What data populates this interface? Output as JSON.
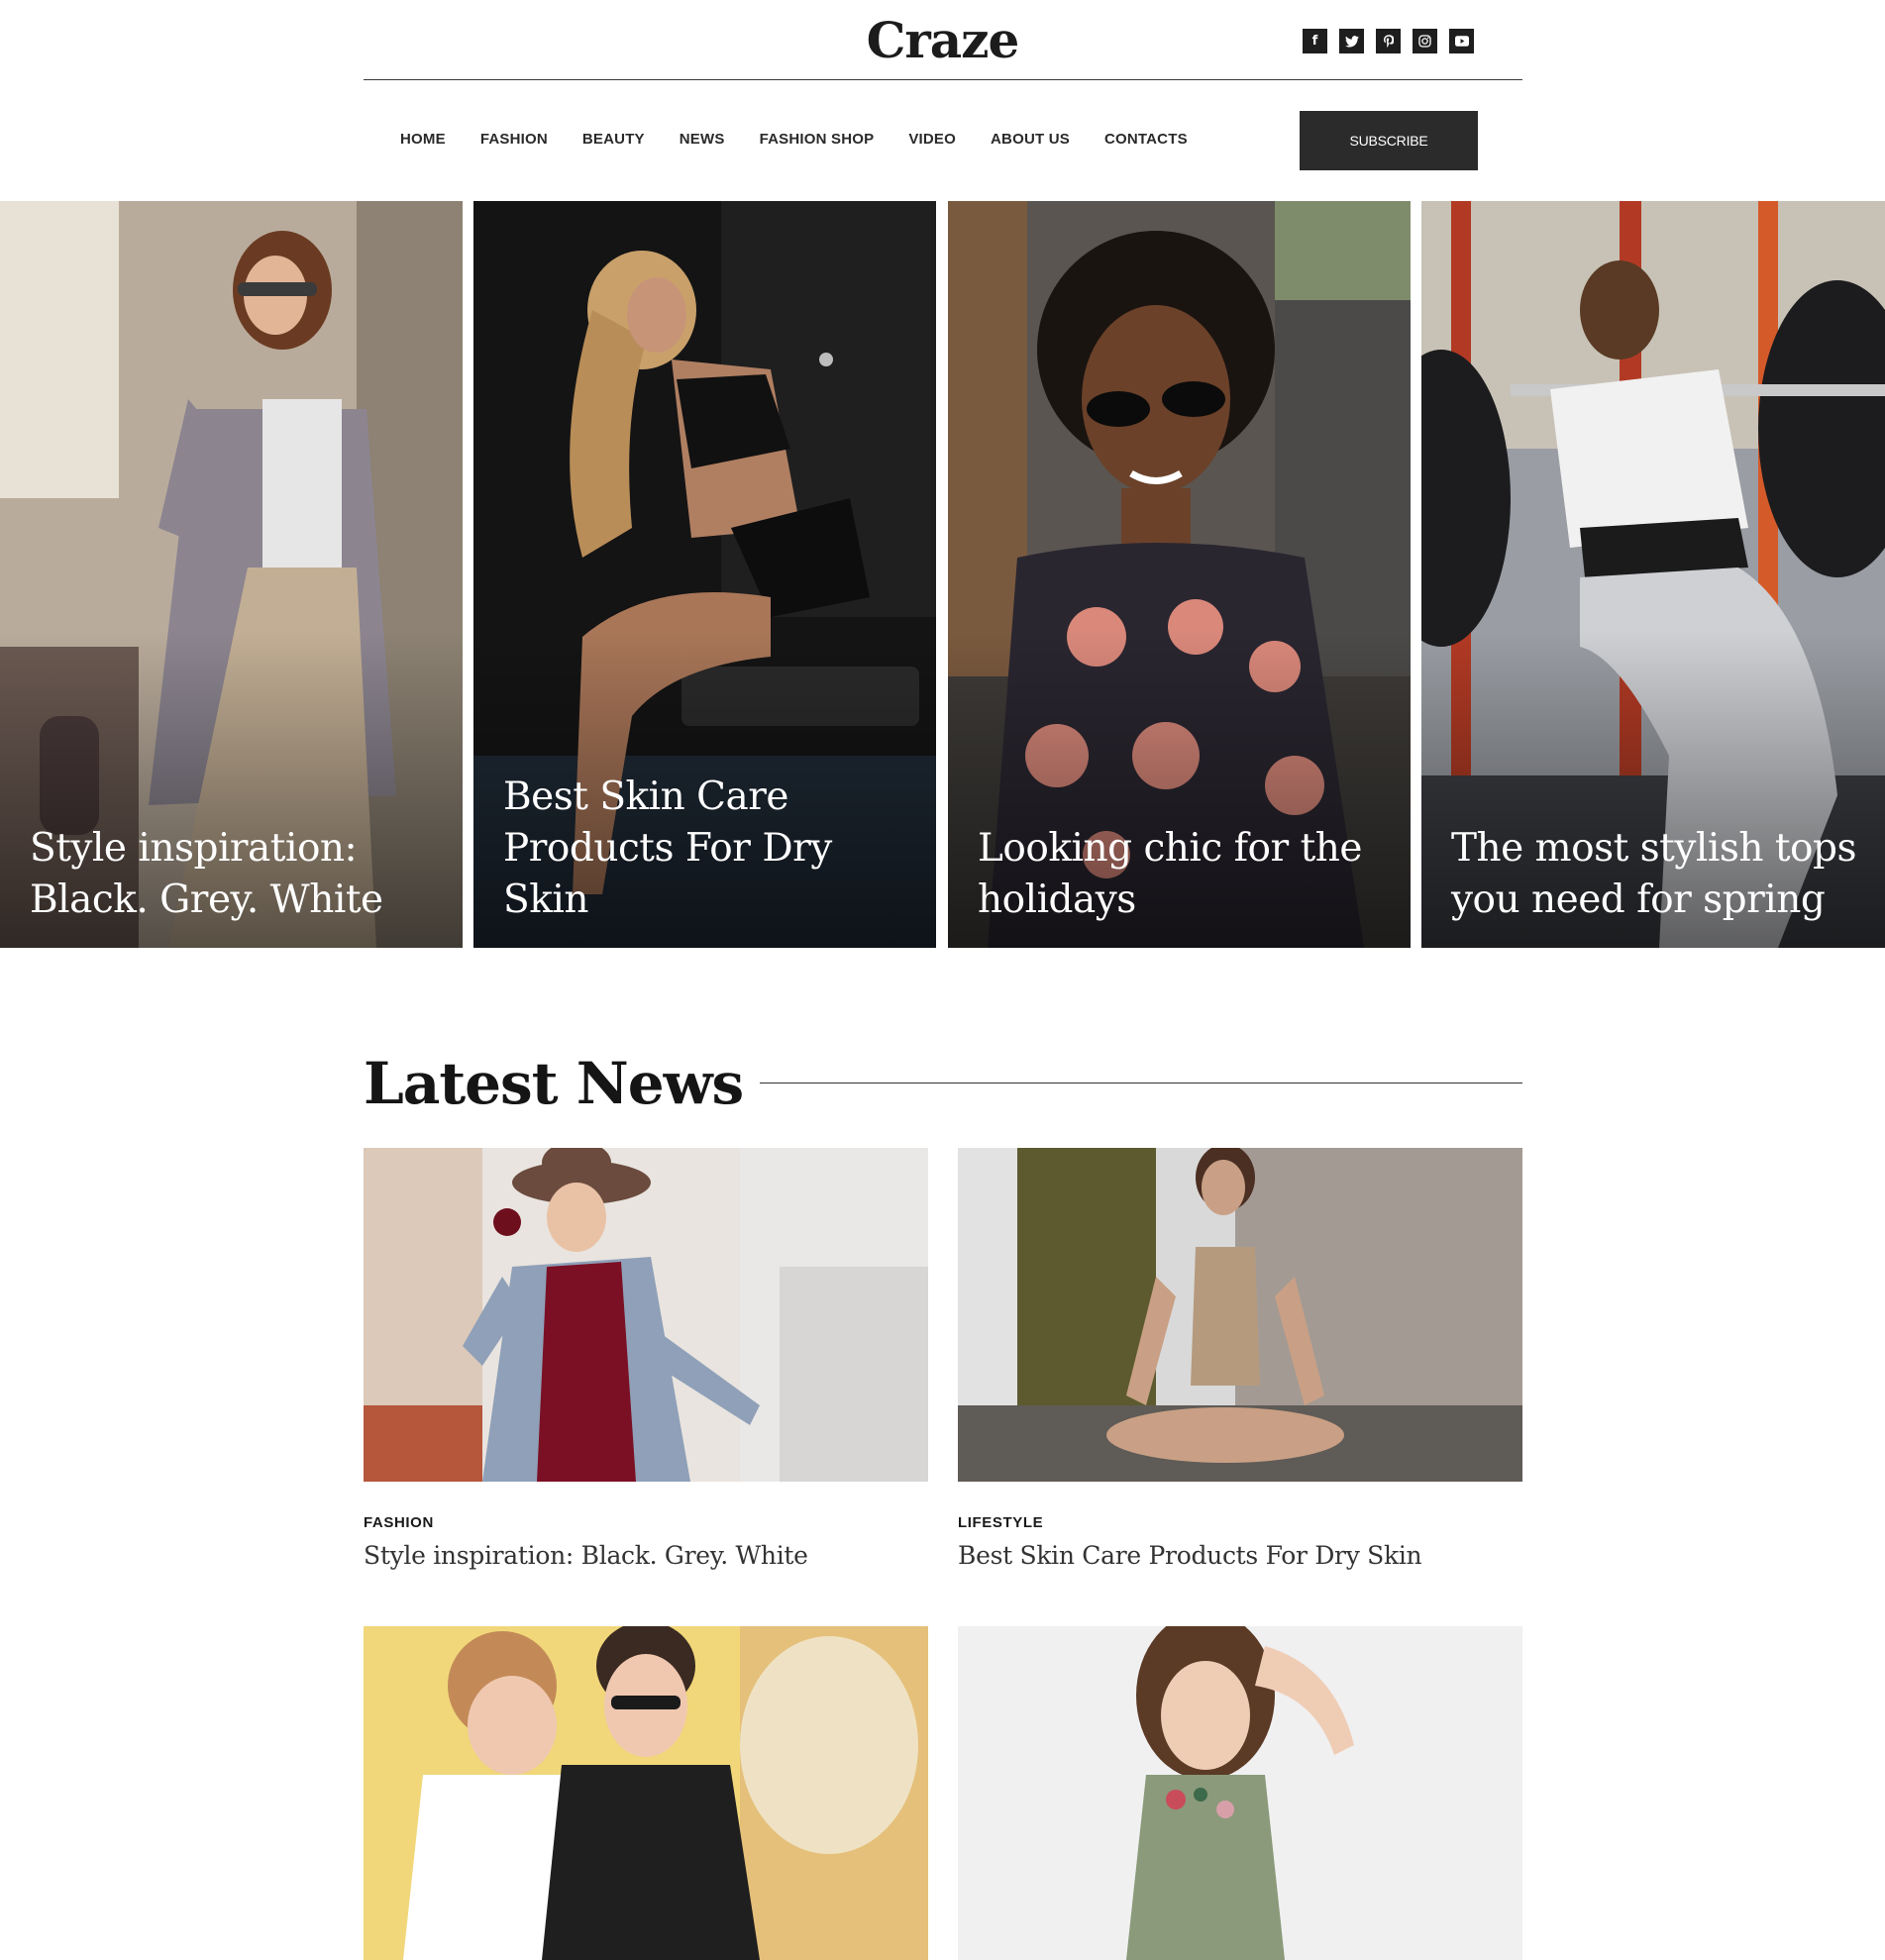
{
  "site": {
    "logo": "Craze"
  },
  "social": [
    {
      "icon": "facebook-icon",
      "glyph": "f"
    },
    {
      "icon": "twitter-icon",
      "glyph": "t"
    },
    {
      "icon": "pinterest-icon",
      "glyph": "p"
    },
    {
      "icon": "instagram-icon",
      "glyph": ""
    },
    {
      "icon": "youtube-icon",
      "glyph": ""
    }
  ],
  "nav": {
    "items": [
      "HOME",
      "FASHION",
      "BEAUTY",
      "NEWS",
      "FASHION SHOP",
      "VIDEO",
      "ABOUT US",
      "CONTACTS"
    ],
    "subscribe_label": "SUBSCRIBE"
  },
  "hero": {
    "cards": [
      {
        "title": "Style inspiration: Black. Grey. White"
      },
      {
        "title": "Best Skin Care Products For Dry Skin"
      },
      {
        "title": "Looking chic for the holidays"
      },
      {
        "title": "The most stylish tops you need for spring"
      }
    ]
  },
  "latest": {
    "heading": "Latest News",
    "posts": [
      {
        "category": "FASHION",
        "title": "Style inspiration: Black. Grey. White"
      },
      {
        "category": "LIFESTYLE",
        "title": "Best Skin Care Products For Dry Skin"
      },
      {
        "category": "",
        "title": ""
      },
      {
        "category": "",
        "title": ""
      }
    ]
  },
  "colors": {
    "text": "#222222",
    "button_bg": "#2b2b2b",
    "rule": "#3a3a3a",
    "background": "#ffffff"
  }
}
